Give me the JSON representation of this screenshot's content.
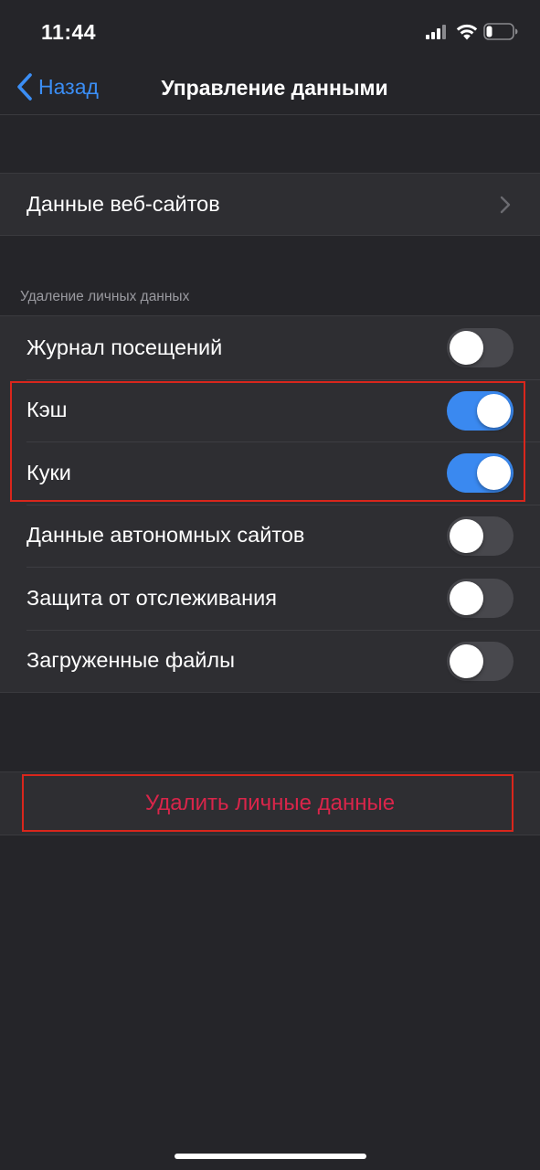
{
  "status_bar": {
    "time": "11:44"
  },
  "nav": {
    "back_label": "Назад",
    "title": "Управление данными"
  },
  "website_data": {
    "label": "Данные веб-сайтов"
  },
  "privacy_section": {
    "header": "Удаление личных данных",
    "items": [
      {
        "label": "Журнал посещений",
        "enabled": false
      },
      {
        "label": "Кэш",
        "enabled": true
      },
      {
        "label": "Куки",
        "enabled": true
      },
      {
        "label": "Данные автономных сайтов",
        "enabled": false
      },
      {
        "label": "Защита от отслеживания",
        "enabled": false
      },
      {
        "label": "Загруженные файлы",
        "enabled": false
      }
    ]
  },
  "delete_action": {
    "label": "Удалить личные данные"
  },
  "colors": {
    "accent": "#3a89f0",
    "destructive": "#d9254a",
    "highlight": "#d9261c",
    "background": "#252529",
    "cell": "#2e2e32"
  },
  "icons": [
    "back-chevron-icon",
    "chevron-right-icon",
    "signal-icon",
    "wifi-icon",
    "battery-icon"
  ]
}
